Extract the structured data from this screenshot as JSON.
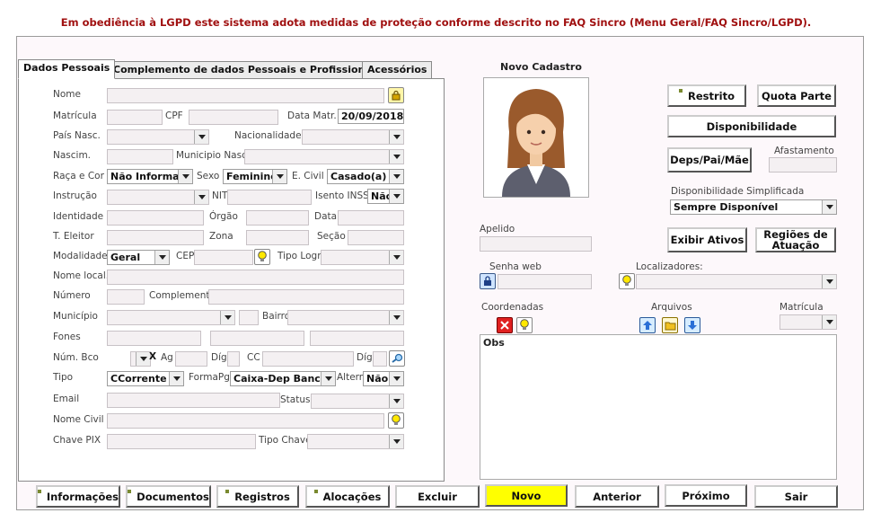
{
  "notice": "Em obediência à LGPD este sistema adota medidas de proteção conforme descrito no FAQ Sincro (Menu Geral/FAQ Sincro/LGPD).",
  "dot": ".",
  "tabs": [
    "Dados Pessoais",
    "Complemento de dados Pessoais e Profissionais",
    "Acessórios"
  ],
  "form": {
    "nome": "Nome",
    "matricula": "Matrícula",
    "cpf": "CPF",
    "data_matr": "Data Matr.",
    "data_matr_value": "20/09/2018",
    "pais_nasc": "País Nasc.",
    "nacionalidade": "Nacionalidade",
    "nascim": "Nascim.",
    "municipio_nasc": "Municipio Nasc.",
    "raca_cor": "Raça e Cor",
    "raca_value": "Não Informad",
    "sexo": "Sexo",
    "sexo_value": "Feminino",
    "estado_civil": "E. Civil",
    "estado_civil_value": "Casado(a)",
    "instrucao": "Instrução",
    "nit": "NIT",
    "isento_inss": "Isento INSS",
    "isento_value": "Não",
    "identidade": "Identidade",
    "orgao": "Órgão",
    "data": "Data",
    "titulo_eleitor": "T. Eleitor",
    "zona": "Zona",
    "secao": "Seção",
    "modalidade": "Modalidade",
    "modalidade_value": "Geral",
    "cep": "CEP",
    "tipo_logr": "Tipo Logr.",
    "nome_local": "Nome local.",
    "numero": "Número",
    "complemento": "Complemento",
    "municipio": "Município",
    "bairro": "Bairro",
    "fones": "Fones",
    "num_bco": "Núm. Bco",
    "x": "X",
    "ag": "Ag",
    "dig1": "Díg",
    "cc": "CC",
    "dig2": "Díg",
    "tipo": "Tipo",
    "tipo_value": "CCorrente",
    "formapg": "FormaPg:",
    "formapg_value": "Caixa-Dep Bancari",
    "altern": "Altern",
    "altern_value": "Não",
    "email": "Email",
    "status": "Status",
    "nome_civil": "Nome Civil",
    "chave_pix": "Chave PIX",
    "tipo_chave": "Tipo Chave"
  },
  "right": {
    "novo_cadastro": "Novo Cadastro",
    "restrito": "Restrito",
    "quota_parte": "Quota Parte",
    "disponibilidade": "Disponibilidade",
    "deps": "Deps/Pai/Mãe",
    "afastamento": "Afastamento",
    "disp_simplificada": "Disponibilidade Simplificada",
    "disp_simplificada_value": "Sempre Disponível",
    "apelido": "Apelido",
    "exibir_ativos": "Exibir Ativos",
    "regioes_1": "Regiões de",
    "regioes_2": "Atuação",
    "senha_web": "Senha web",
    "localizadores": "Localizadores:",
    "coordenadas": "Coordenadas",
    "arquivos": "Arquivos",
    "matricula": "Matrícula",
    "obs": "Obs"
  },
  "bottom": {
    "informacoes": "Informações",
    "documentos": "Documentos",
    "registros": "Registros",
    "alocacoes": "Alocações",
    "excluir": "Excluir",
    "novo": "Novo",
    "anterior": "Anterior",
    "proximo": "Próximo",
    "sair": "Sair"
  },
  "colors": {
    "notice": "#a01010",
    "frame_bg": "#fdf8fb",
    "novo_button": "#ffff00",
    "field_bg": "#f4f0f2"
  },
  "icons": [
    "lock-icon",
    "lightbulb-icon",
    "search-icon",
    "close-icon",
    "upload-icon",
    "folder-icon",
    "download-icon",
    "avatar-icon"
  ]
}
